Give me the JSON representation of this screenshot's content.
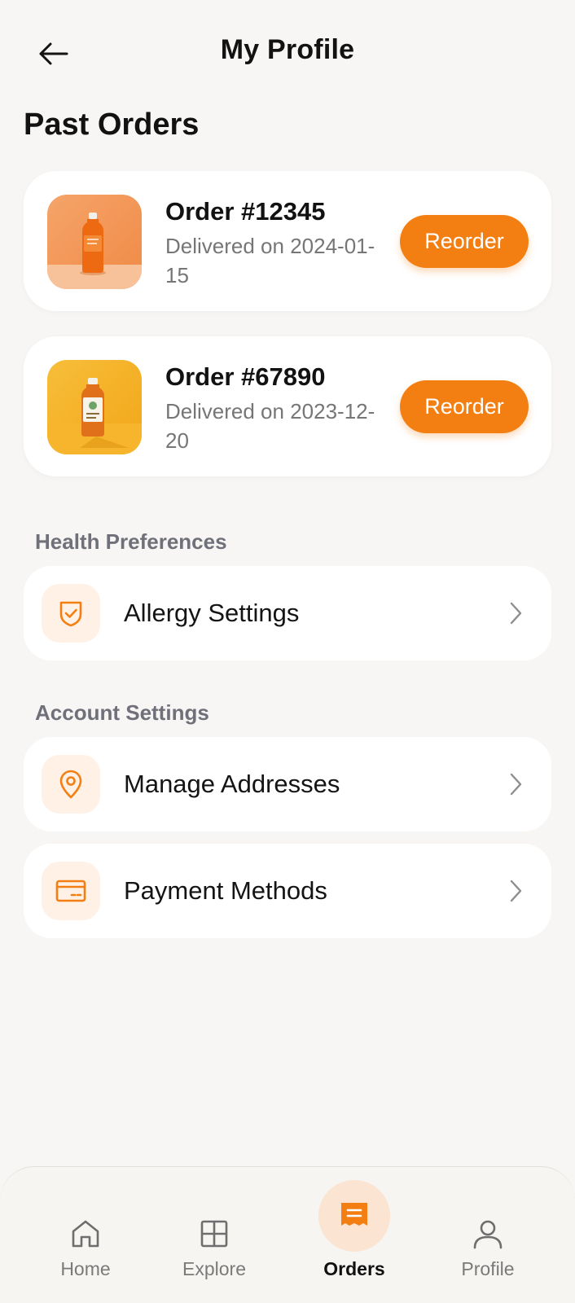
{
  "header": {
    "title": "My Profile"
  },
  "past_orders": {
    "title": "Past Orders",
    "orders": [
      {
        "number": "Order #12345",
        "status": "Delivered on 2024-01-15",
        "button": "Reorder"
      },
      {
        "number": "Order #67890",
        "status": "Delivered on 2023-12-20",
        "button": "Reorder"
      }
    ]
  },
  "health_preferences": {
    "label": "Health Preferences",
    "items": [
      {
        "label": "Allergy Settings",
        "icon": "shield-check-icon"
      }
    ]
  },
  "account_settings": {
    "label": "Account Settings",
    "items": [
      {
        "label": "Manage Addresses",
        "icon": "location-pin-icon"
      },
      {
        "label": "Payment Methods",
        "icon": "credit-card-icon"
      }
    ]
  },
  "bottom_nav": {
    "items": [
      {
        "label": "Home",
        "icon": "home-icon"
      },
      {
        "label": "Explore",
        "icon": "grid-icon"
      },
      {
        "label": "Orders",
        "icon": "receipt-icon",
        "active": true
      },
      {
        "label": "Profile",
        "icon": "user-icon"
      }
    ]
  },
  "colors": {
    "accent": "#f37f12",
    "accent_soft": "#fff1e6",
    "background": "#f7f6f4",
    "card": "#ffffff"
  }
}
